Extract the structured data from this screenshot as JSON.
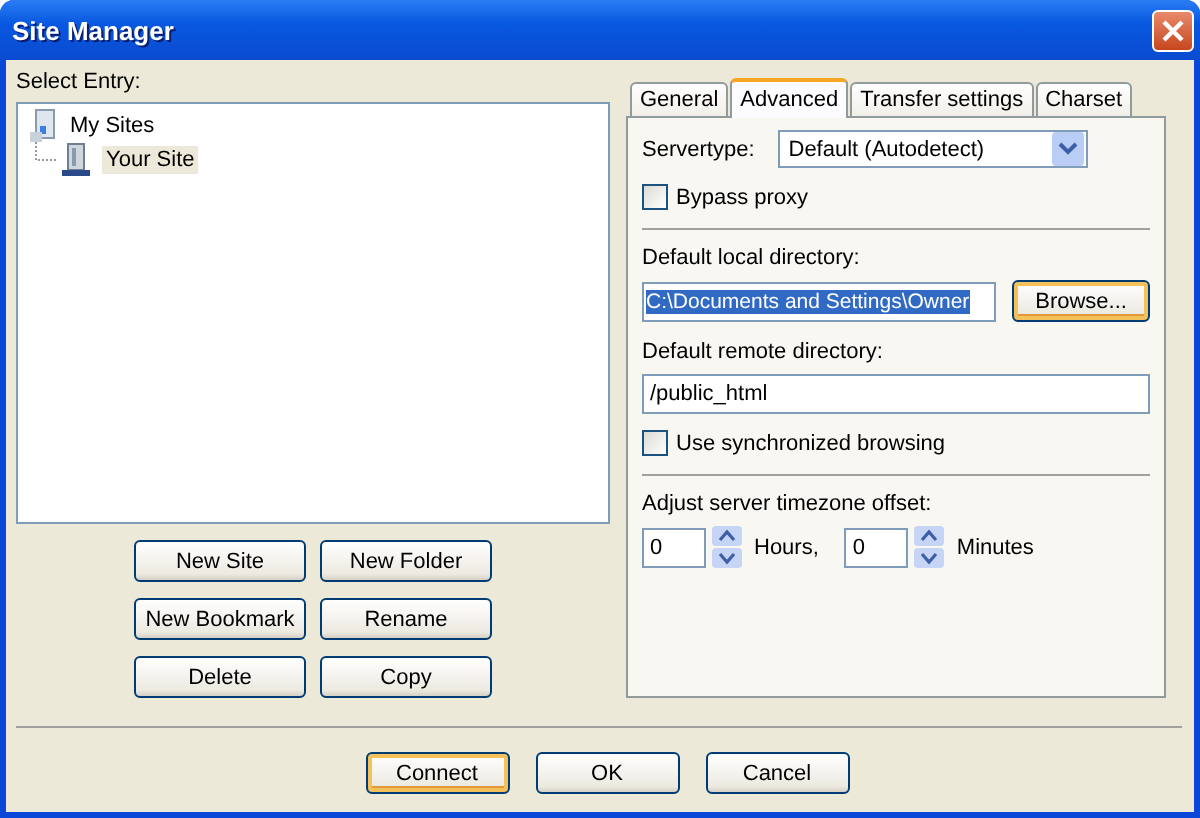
{
  "window": {
    "title": "Site Manager"
  },
  "tree": {
    "label": "Select Entry:",
    "items": [
      {
        "label": "My Sites",
        "kind": "folder",
        "selected": false,
        "children": [
          {
            "label": "Your Site",
            "kind": "site",
            "selected": true
          }
        ]
      }
    ]
  },
  "tree_buttons": [
    {
      "label": "New Site"
    },
    {
      "label": "New Folder"
    },
    {
      "label": "New Bookmark"
    },
    {
      "label": "Rename"
    },
    {
      "label": "Delete"
    },
    {
      "label": "Copy"
    }
  ],
  "tabs": [
    {
      "label": "General",
      "selected": false
    },
    {
      "label": "Advanced",
      "selected": true
    },
    {
      "label": "Transfer settings",
      "selected": false
    },
    {
      "label": "Charset",
      "selected": false
    }
  ],
  "advanced": {
    "servertype_label": "Servertype:",
    "servertype_value": "Default (Autodetect)",
    "bypass_proxy": {
      "label": "Bypass proxy",
      "checked": false
    },
    "local_dir_label": "Default local directory:",
    "local_dir_value": "C:\\Documents and Settings\\Owner",
    "local_dir_text_selected": true,
    "browse_button": {
      "label": "Browse...",
      "default": true
    },
    "remote_dir_label": "Default remote directory:",
    "remote_dir_value": "/public_html",
    "sync_browsing": {
      "label": "Use synchronized browsing",
      "checked": false
    },
    "timezone_label": "Adjust server timezone offset:",
    "hours_value": "0",
    "hours_label": "Hours,",
    "minutes_value": "0",
    "minutes_label": "Minutes"
  },
  "buttons": [
    {
      "label": "Connect",
      "default": true
    },
    {
      "label": "OK",
      "default": false
    },
    {
      "label": "Cancel",
      "default": false
    }
  ]
}
